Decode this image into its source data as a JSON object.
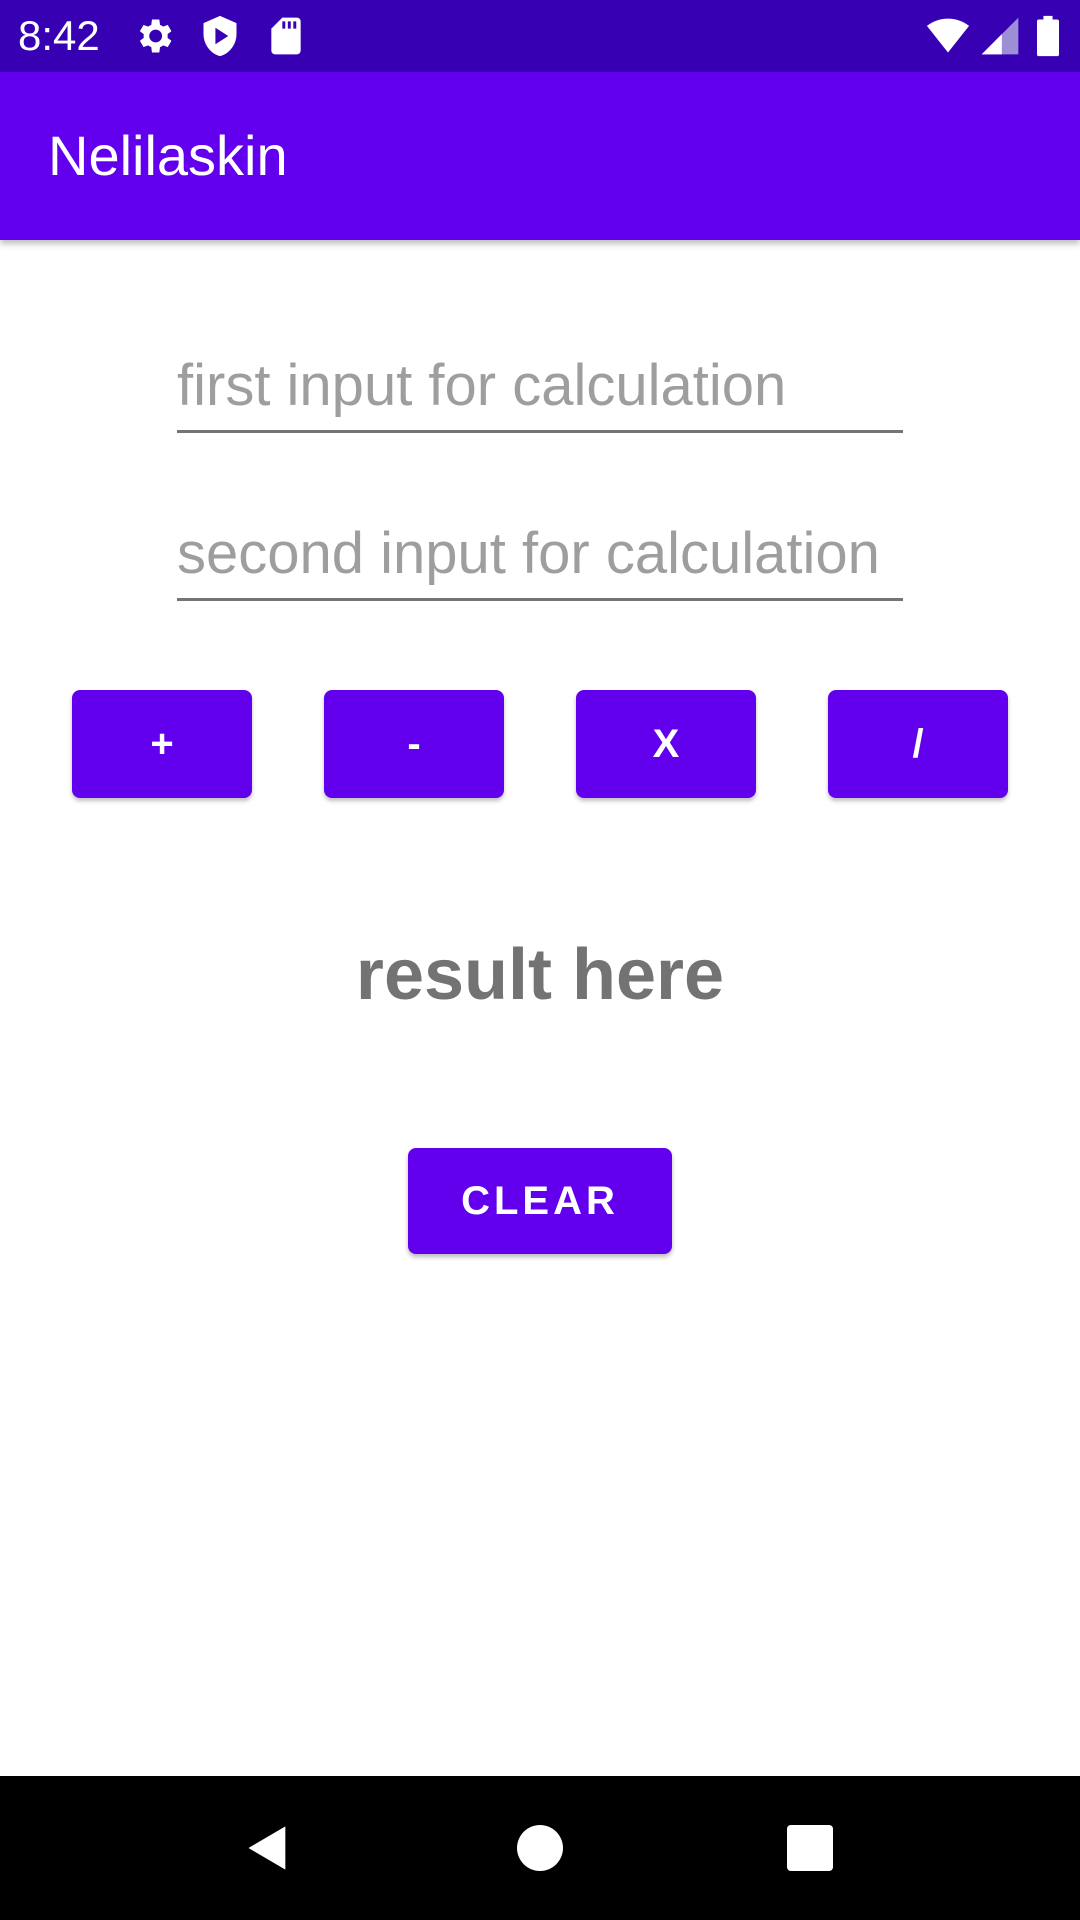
{
  "status_bar": {
    "time": "8:42",
    "icons": [
      "gear-icon",
      "shield-play-icon",
      "sd-card-icon",
      "wifi-icon",
      "cellular-signal-icon",
      "battery-icon"
    ]
  },
  "app_bar": {
    "title": "Nelilaskin"
  },
  "inputs": {
    "first_placeholder": "first input for calculation",
    "second_placeholder": "second input for calculation"
  },
  "operators": {
    "add": "+",
    "subtract": "-",
    "multiply": "X",
    "divide": "/"
  },
  "result": {
    "text": "result here"
  },
  "clear_button": {
    "label": "CLEAR"
  },
  "nav_bar": {
    "icons": [
      "back-icon",
      "home-icon",
      "recents-icon"
    ]
  },
  "colors": {
    "status_bar": "#3700b3",
    "primary": "#6200ee",
    "result_text": "#737373",
    "nav_bar": "#000000"
  }
}
